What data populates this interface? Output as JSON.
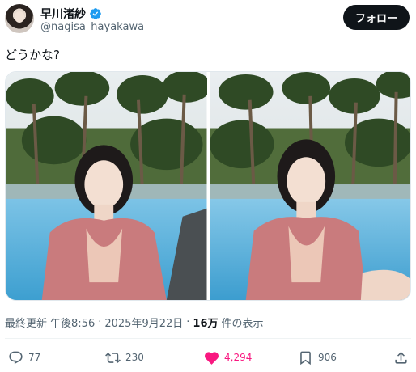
{
  "author": {
    "display_name": "早川渚紗",
    "handle": "@nagisa_hayakawa",
    "verified_icon": "verified-badge-icon",
    "follow_label": "フォロー"
  },
  "tweet": {
    "text": "どうかな?"
  },
  "media": {
    "photos": [
      {
        "icon": "photo-poolside-1"
      },
      {
        "icon": "photo-poolside-2"
      }
    ]
  },
  "meta": {
    "prefix": "最終更新",
    "time": "午後8:56",
    "separator": "·",
    "date": "2025年9月22日",
    "views_count": "16万",
    "views_label": "件の表示"
  },
  "actions": {
    "reply_count": "77",
    "retweet_count": "230",
    "like_count": "4,294",
    "bookmark_count": "906"
  },
  "colors": {
    "accent": "#1d9bf0",
    "like": "#f91880",
    "text_secondary": "#536471"
  }
}
